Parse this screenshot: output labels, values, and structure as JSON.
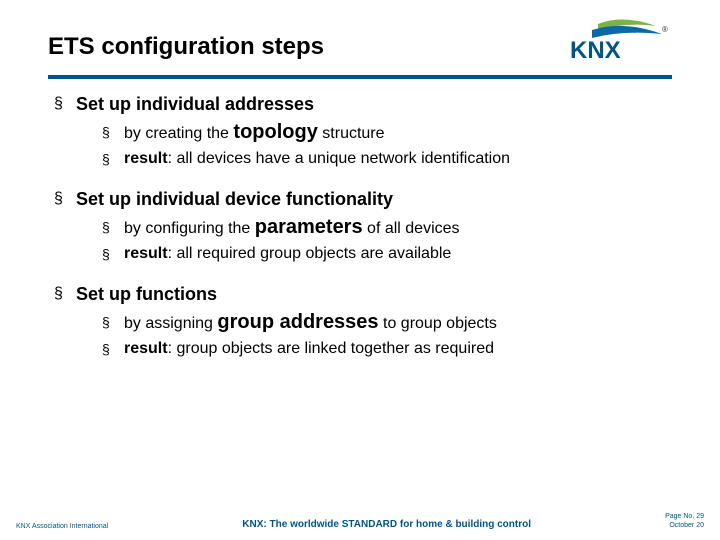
{
  "title": "ETS configuration steps",
  "logo": {
    "brand_text": "KNX",
    "swoosh_color_top": "#7cb342",
    "swoosh_color_bottom": "#0b6aa3",
    "trademark": "®"
  },
  "sections": [
    {
      "heading": "Set up individual addresses",
      "subs": [
        {
          "before": "by creating the ",
          "emph": "topology",
          "after": " structure"
        },
        {
          "result_label": "result",
          "result_text": ": all devices have a unique network identification"
        }
      ]
    },
    {
      "heading": "Set up individual device functionality",
      "subs": [
        {
          "before": "by configuring the ",
          "emph": "parameters",
          "after": " of all devices"
        },
        {
          "result_label": "result",
          "result_text": ": all required group objects are available"
        }
      ]
    },
    {
      "heading": "Set up functions",
      "subs": [
        {
          "before": "by assigning ",
          "emph": "group addresses",
          "after": " to group objects"
        },
        {
          "result_label": "result",
          "result_text": ": group objects are linked together as required"
        }
      ]
    }
  ],
  "footer": {
    "left": "KNX Association International",
    "center": "KNX: The worldwide STANDARD for home & building control",
    "page": "Page No. 29",
    "date": "October 20"
  },
  "glyphs": {
    "square": "§"
  }
}
